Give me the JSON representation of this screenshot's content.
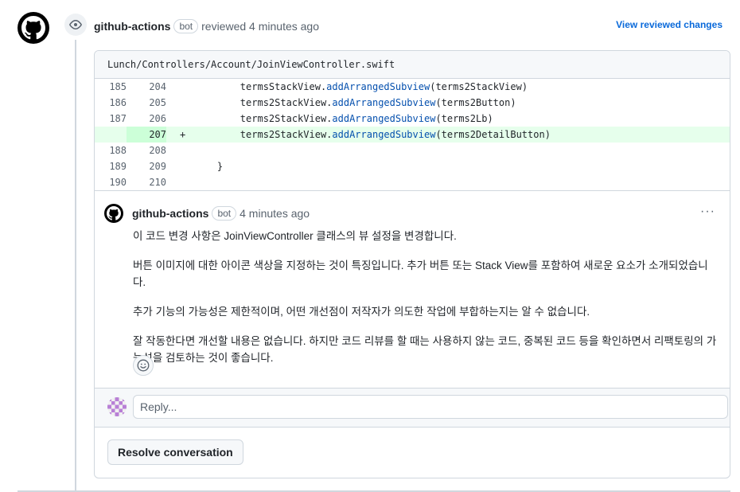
{
  "review": {
    "author": "github-actions",
    "bot_label": "bot",
    "action": "reviewed 4 minutes ago",
    "view_link": "View reviewed changes",
    "eye_icon": "eye-icon"
  },
  "file": {
    "path": "Lunch/Controllers/Account/JoinViewController.swift"
  },
  "diff_lines": [
    {
      "old": "185",
      "new": "204",
      "marker": "",
      "obj": "termsStackView.",
      "method": "addArrangedSubview",
      "rest": "(terms2StackView)",
      "added": false
    },
    {
      "old": "186",
      "new": "205",
      "marker": "",
      "obj": "terms2StackView.",
      "method": "addArrangedSubview",
      "rest": "(terms2Button)",
      "added": false
    },
    {
      "old": "187",
      "new": "206",
      "marker": "",
      "obj": "terms2StackView.",
      "method": "addArrangedSubview",
      "rest": "(terms2Lb)",
      "added": false
    },
    {
      "old": "",
      "new": "207",
      "marker": "+",
      "obj": "terms2StackView.",
      "method": "addArrangedSubview",
      "rest": "(terms2DetailButton)",
      "added": true
    },
    {
      "old": "188",
      "new": "208",
      "marker": "",
      "obj": "",
      "method": "",
      "rest": "",
      "added": false
    },
    {
      "old": "189",
      "new": "209",
      "marker": "",
      "obj": "}",
      "method": "",
      "rest": "",
      "added": false
    },
    {
      "old": "190",
      "new": "210",
      "marker": "",
      "obj": "",
      "method": "",
      "rest": "",
      "added": false
    }
  ],
  "comment": {
    "author": "github-actions",
    "bot_label": "bot",
    "time": "4 minutes ago",
    "menu": "···",
    "paragraphs": [
      "이 코드 변경 사항은 JoinViewController 클래스의 뷰 설정을 변경합니다.",
      "버튼 이미지에 대한 아이콘 색상을 지정하는 것이 특징입니다. 추가 버튼 또는 Stack View를 포함하여 새로운 요소가 소개되었습니다.",
      "추가 기능의 가능성은 제한적이며, 어떤 개선점이 저작자가 의도한 작업에 부합하는지는 알 수 없습니다.",
      "잘 작동한다면 개선할 내용은 없습니다. 하지만 코드 리뷰를 할 때는 사용하지 않는 코드, 중복된 코드 등을 확인하면서 리팩토링의 가능성을 검토하는 것이 좋습니다."
    ]
  },
  "reply": {
    "placeholder": "Reply..."
  },
  "resolve_label": "Resolve conversation",
  "colors": {
    "link": "#0969da",
    "added_bg": "#e6ffec",
    "added_gutter": "#ccffd8",
    "method": "#0550ae",
    "border": "#d0d7de"
  }
}
